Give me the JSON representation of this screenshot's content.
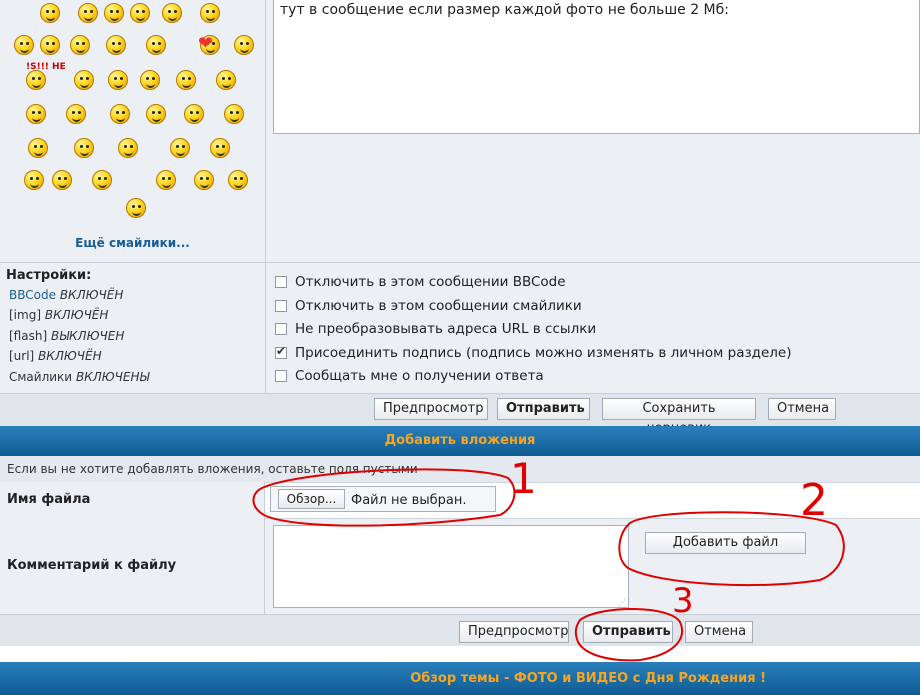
{
  "message": {
    "text": "тут в сообщение если размер каждой фото не больше 2 Мб:"
  },
  "smilies": {
    "more_label": "Ещё смайлики...",
    "badge_text": "!S!!! НЕ"
  },
  "settings": {
    "title": "Настройки:",
    "rows": [
      {
        "name": "BBCode",
        "state": "ВКЛЮЧЁН"
      },
      {
        "name": "[img]",
        "state": "ВКЛЮЧЁН"
      },
      {
        "name": "[flash]",
        "state": "ВЫКЛЮЧЕН"
      },
      {
        "name": "[url]",
        "state": "ВКЛЮЧЁН"
      },
      {
        "name": "Смайлики",
        "state": "ВКЛЮЧЕНЫ"
      }
    ]
  },
  "options": [
    {
      "label": "Отключить в этом сообщении BBCode",
      "checked": false
    },
    {
      "label": "Отключить в этом сообщении смайлики",
      "checked": false
    },
    {
      "label": "Не преобразовывать адреса URL в ссылки",
      "checked": false
    },
    {
      "label": "Присоединить подпись (подпись можно изменять в личном разделе)",
      "checked": true
    },
    {
      "label": "Сообщать мне о получении ответа",
      "checked": false
    }
  ],
  "buttons_top": {
    "preview": "Предпросмотр",
    "submit": "Отправить",
    "save_draft": "Сохранить черновик",
    "cancel": "Отмена"
  },
  "attachments": {
    "header": "Добавить вложения",
    "note": "Если вы не хотите добавлять вложения, оставьте поля пустыми",
    "filename_label": "Имя файла",
    "browse_label": "Обзор...",
    "no_file_text": "Файл не выбран.",
    "comment_label": "Комментарий к файлу",
    "add_file_label": "Добавить файл"
  },
  "buttons_bottom": {
    "preview": "Предпросмотр",
    "submit": "Отправить",
    "cancel": "Отмена"
  },
  "topic_review": {
    "header": "Обзор темы - ФОТО и ВИДЕО с Дня Рождения !"
  },
  "annotations": [
    "1",
    "2",
    "3"
  ],
  "colors": {
    "header_gradient_top": "#2a7fbb",
    "header_gradient_bottom": "#105c93",
    "header_text": "#f5a623",
    "annotation_red": "#e00000",
    "link": "#1a5e98"
  }
}
